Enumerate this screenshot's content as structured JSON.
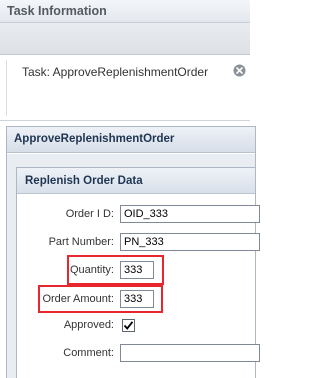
{
  "window": {
    "title": "Task Information"
  },
  "tab": {
    "title": "Task: ApproveReplenishmentOrder",
    "close_icon": "close-circle-icon"
  },
  "panel": {
    "title": "ApproveReplenishmentOrder"
  },
  "section": {
    "title": "Replenish Order Data"
  },
  "form": {
    "order_id": {
      "label": "Order I D:",
      "value": "OID_333"
    },
    "part_number": {
      "label": "Part Number:",
      "value": "PN_333"
    },
    "quantity": {
      "label": "Quantity:",
      "value": "333"
    },
    "order_amount": {
      "label": "Order Amount:",
      "value": "333"
    },
    "approved": {
      "label": "Approved:",
      "checked": true
    },
    "comment": {
      "label": "Comment:",
      "value": ""
    }
  },
  "colors": {
    "highlight": "#e8262d",
    "header_text": "#1f3552"
  }
}
